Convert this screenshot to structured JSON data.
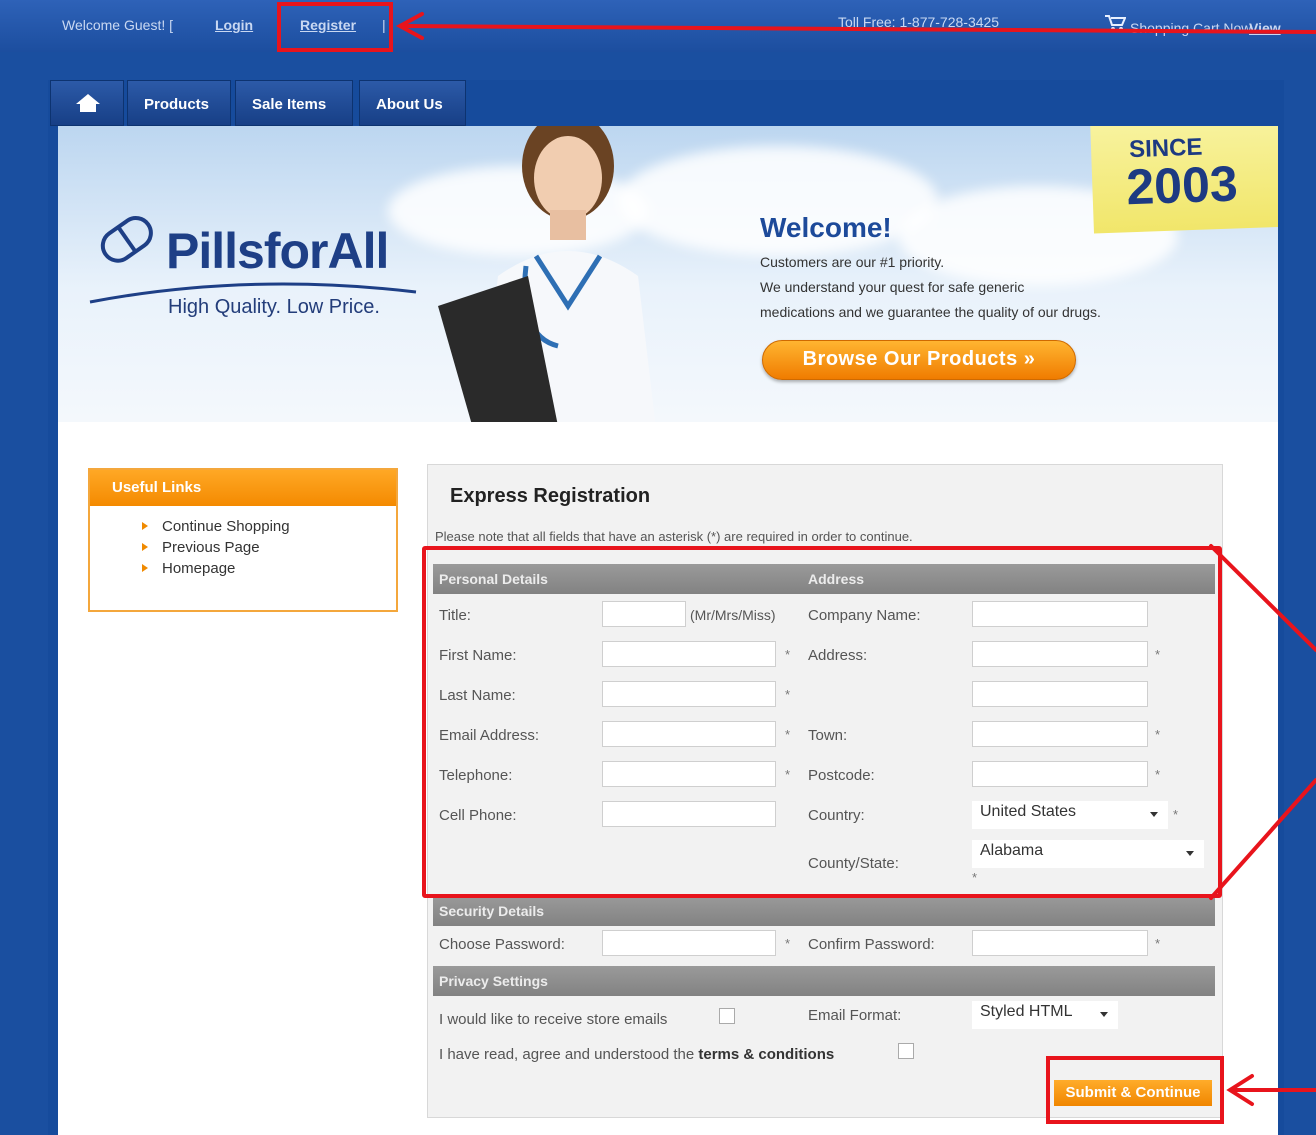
{
  "topbar": {
    "welcome": "Welcome Guest! [",
    "login": "Login",
    "register": "Register",
    "separator": "|",
    "toll_free": "Toll Free: 1-877-728-3425",
    "cart_label": "Shopping Cart Now",
    "cart_view": "View"
  },
  "nav": {
    "home_icon": "home-icon",
    "tabs": [
      "Products",
      "Sale Items",
      "About Us"
    ]
  },
  "hero": {
    "brand": "PillsforAll",
    "tagline": "High Quality. Low Price.",
    "welcome_title": "Welcome!",
    "welcome_lines": [
      "Customers are our #1 priority.",
      "We understand your quest for safe generic",
      "medications and we guarantee the quality of our drugs."
    ],
    "browse_button": "Browse Our Products »",
    "since_label": "SINCE",
    "since_year": "2003"
  },
  "useful_links": {
    "title": "Useful Links",
    "items": [
      "Continue Shopping",
      "Previous Page",
      "Homepage"
    ]
  },
  "registration": {
    "title": "Express Registration",
    "note": "Please note that all fields that have an asterisk (*) are required in order to continue.",
    "sections": {
      "personal": "Personal Details",
      "address": "Address",
      "security": "Security Details",
      "privacy": "Privacy Settings"
    },
    "labels": {
      "title": "Title:",
      "title_hint": "(Mr/Mrs/Miss)",
      "first_name": "First Name:",
      "last_name": "Last Name:",
      "email": "Email Address:",
      "telephone": "Telephone:",
      "cell": "Cell Phone:",
      "company": "Company Name:",
      "address": "Address:",
      "town": "Town:",
      "postcode": "Postcode:",
      "country": "Country:",
      "county": "County/State:",
      "choose_password": "Choose Password:",
      "confirm_password": "Confirm Password:",
      "store_emails": "I would like to receive store emails",
      "email_format": "Email Format:",
      "terms_prefix": "I have read, agree and understood the ",
      "terms_link": "terms & conditions"
    },
    "asterisk": "*",
    "country_value": "United States",
    "county_value": "Alabama",
    "email_format_value": "Styled HTML",
    "submit": "Submit & Continue"
  },
  "colors": {
    "annotation": "#e8141c",
    "accent_orange": "#f08600",
    "brand_blue": "#1d4a9a"
  }
}
